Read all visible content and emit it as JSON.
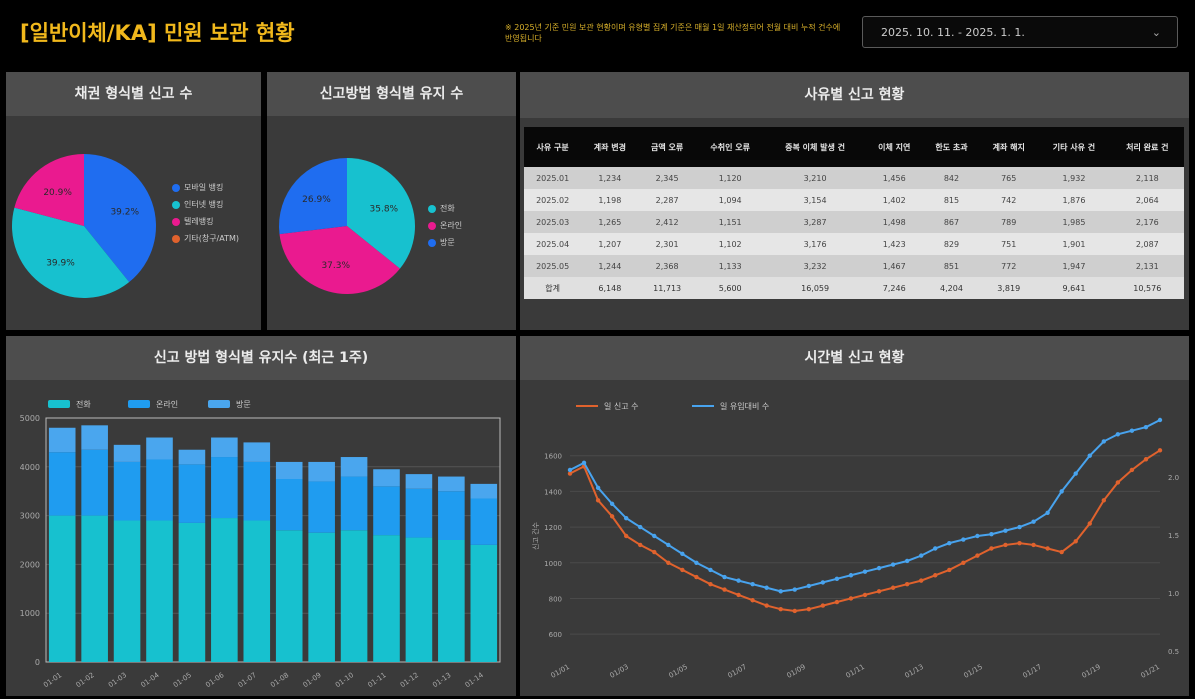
{
  "header": {
    "title": "[일반이체/KA] 민원 보관 현황",
    "note": "※ 2025년 기준 민원 보관 현황이며 유형별 집계 기준은 매월 1일 재산정되어 전월 대비 누적 건수에 반영됩니다",
    "date_range": "2025. 10. 11. - 2025. 1. 1.",
    "chevron": "⌄"
  },
  "panels": {
    "pie1_title": "채권 형식별 신고 수",
    "pie2_title": "신고방법 형식별 유지 수",
    "table_title": "사유별 신고 현황",
    "bar_title": "신고 방법 형식별 유지수 (최근 1주)",
    "line_title": "시간별 신고 현황"
  },
  "colors": {
    "accent": "#f1b81c",
    "blue": "#1f6df0",
    "cyan": "#17c1cf",
    "magenta": "#ea1a8f",
    "orange": "#e0622d",
    "lightblue": "#48a3ee"
  },
  "table": {
    "headers": [
      "사유 구분",
      "계좌 변경",
      "금액 오류",
      "수취인 오류",
      "중복 이체 발생 건",
      "이체 지연",
      "한도 초과",
      "계좌 해지",
      "기타 사유 건",
      "처리 완료 건"
    ],
    "rows": [
      [
        "2025.01",
        "1,234",
        "2,345",
        "1,120",
        "3,210",
        "1,456",
        "842",
        "765",
        "1,932",
        "2,118"
      ],
      [
        "2025.02",
        "1,198",
        "2,287",
        "1,094",
        "3,154",
        "1,402",
        "815",
        "742",
        "1,876",
        "2,064"
      ],
      [
        "2025.03",
        "1,265",
        "2,412",
        "1,151",
        "3,287",
        "1,498",
        "867",
        "789",
        "1,985",
        "2,176"
      ],
      [
        "2025.04",
        "1,207",
        "2,301",
        "1,102",
        "3,176",
        "1,423",
        "829",
        "751",
        "1,901",
        "2,087"
      ],
      [
        "2025.05",
        "1,244",
        "2,368",
        "1,133",
        "3,232",
        "1,467",
        "851",
        "772",
        "1,947",
        "2,131"
      ]
    ],
    "total": [
      "합계",
      "6,148",
      "11,713",
      "5,600",
      "16,059",
      "7,246",
      "4,204",
      "3,819",
      "9,641",
      "10,576"
    ]
  },
  "chart_data": [
    {
      "type": "pie",
      "title": "채권 형식별 신고 수",
      "labels": [
        "모바일 뱅킹",
        "인터넷 뱅킹",
        "텔레뱅킹",
        "기타(창구/ATM)"
      ],
      "values": [
        39.2,
        39.9,
        20.9,
        0.0
      ],
      "colors": [
        "#1f6df0",
        "#17c1cf",
        "#ea1a8f",
        "#e0622d"
      ],
      "value_labels": [
        "39.2%",
        "39.9%",
        "20.9%",
        ""
      ]
    },
    {
      "type": "pie",
      "title": "신고방법 형식별 유지 수",
      "labels": [
        "전화",
        "온라인",
        "방문"
      ],
      "values": [
        35.8,
        37.3,
        26.9
      ],
      "colors": [
        "#17c1cf",
        "#ea1a8f",
        "#1f6df0"
      ],
      "value_labels": [
        "35.8%",
        "37.3%",
        "26.9%"
      ]
    },
    {
      "type": "bar",
      "stacked": true,
      "title": "신고 방법 형식별 유지수 (최근 1주)",
      "categories": [
        "01-01",
        "01-02",
        "01-03",
        "01-04",
        "01-05",
        "01-06",
        "01-07",
        "01-08",
        "01-09",
        "01-10",
        "01-11",
        "01-12",
        "01-13",
        "01-14"
      ],
      "series": [
        {
          "name": "전화",
          "color": "#17c1cf",
          "values": [
            3000,
            3000,
            2900,
            2900,
            2850,
            2950,
            2900,
            2700,
            2650,
            2700,
            2600,
            2550,
            2500,
            2400
          ]
        },
        {
          "name": "온라인",
          "color": "#1f9cf0",
          "values": [
            1300,
            1350,
            1200,
            1250,
            1200,
            1250,
            1200,
            1050,
            1050,
            1100,
            1000,
            1000,
            1000,
            950
          ]
        },
        {
          "name": "방문",
          "color": "#4aa6ee",
          "values": [
            500,
            500,
            350,
            450,
            300,
            400,
            400,
            350,
            400,
            400,
            350,
            300,
            300,
            300
          ]
        }
      ],
      "ylim": [
        0,
        5000
      ],
      "yticks": [
        0,
        1000,
        2000,
        3000,
        4000,
        5000
      ]
    },
    {
      "type": "line",
      "title": "시간별 신고 현황",
      "series": [
        {
          "name": "일 신고 수",
          "color": "#e0622d",
          "values": [
            1500,
            1540,
            1350,
            1260,
            1150,
            1100,
            1060,
            1000,
            960,
            920,
            880,
            850,
            820,
            790,
            760,
            740,
            730,
            740,
            760,
            780,
            800,
            820,
            840,
            860,
            880,
            900,
            930,
            960,
            1000,
            1040,
            1080,
            1100,
            1110,
            1100,
            1080,
            1060,
            1120,
            1220,
            1350,
            1450,
            1520,
            1580,
            1630
          ]
        },
        {
          "name": "일 유입대비 수",
          "color": "#48a3ee",
          "values": [
            1520,
            1560,
            1420,
            1330,
            1250,
            1200,
            1150,
            1100,
            1050,
            1000,
            960,
            920,
            900,
            880,
            860,
            840,
            850,
            870,
            890,
            910,
            930,
            950,
            970,
            990,
            1010,
            1040,
            1080,
            1110,
            1130,
            1150,
            1160,
            1180,
            1200,
            1230,
            1280,
            1400,
            1500,
            1600,
            1680,
            1720,
            1740,
            1760,
            1800
          ]
        }
      ],
      "ylim": [
        500,
        1800
      ],
      "yticks": [
        600,
        800,
        1000,
        1200,
        1400,
        1600
      ],
      "y2ticks": [
        "2.0",
        "1.5",
        "1.0",
        "0.5"
      ],
      "xlabels": [
        "01/01",
        "01/03",
        "01/05",
        "01/07",
        "01/09",
        "01/11",
        "01/13",
        "01/15",
        "01/17",
        "01/19",
        "01/21"
      ],
      "ylabel": "신고 건수"
    }
  ]
}
